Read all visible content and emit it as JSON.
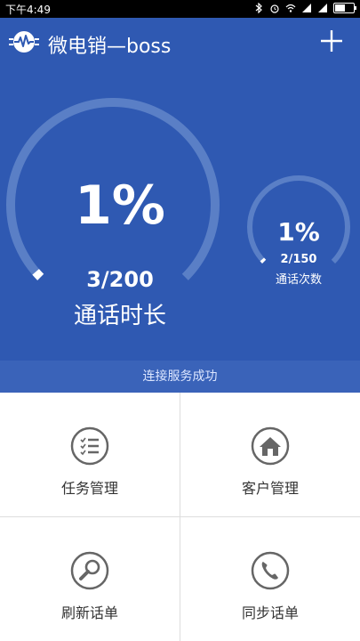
{
  "statusbar": {
    "time": "下午4:49",
    "battery_level": 0.6
  },
  "app": {
    "title": "微电销—boss",
    "accent": "#2f59b2"
  },
  "call_duration": {
    "percent": "1%",
    "ratio": "3/200",
    "label": "通话时长",
    "progress": 0.015
  },
  "call_count": {
    "percent": "1%",
    "ratio": "2/150",
    "label": "通话次数",
    "progress": 0.013
  },
  "connection": {
    "status": "连接服务成功"
  },
  "menu": {
    "task": "任务管理",
    "customer": "客户管理",
    "refresh": "刷新话单",
    "sync": "同步话单"
  }
}
